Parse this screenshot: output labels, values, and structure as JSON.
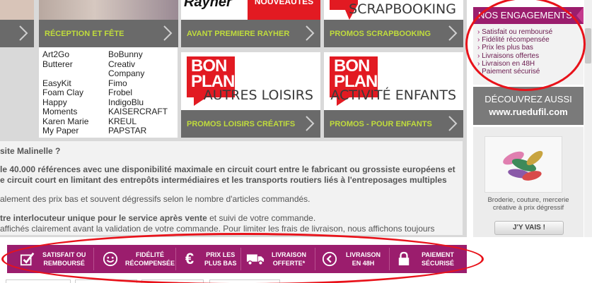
{
  "tiles": {
    "reception": {
      "label": "RÉCEPTION ET FÊTE"
    },
    "rayher": {
      "label": "AVANT PREMIERE RAYHER",
      "brand": "Rayher",
      "badge": "NOUVEAUTÉS"
    },
    "scrap": {
      "label": "PROMOS SCRAPBOOKING",
      "caption": "SCRAPBOOKING"
    },
    "autres": {
      "label": "PROMOS LOISIRS CRÉATIFS",
      "caption": "AUTRES LOISIRS",
      "badge_line1": "BON",
      "badge_line2": "PLAN"
    },
    "enfants": {
      "label": "PROMOS - POUR ENFANTS",
      "caption": "ACTIVITÉ ENFANTS",
      "badge_line1": "BON",
      "badge_line2": "PLAN"
    }
  },
  "brands": {
    "col1": [
      "Art2Go",
      "Butterer",
      "",
      "EasyKit",
      "Foam Clay",
      "Happy",
      "Moments",
      "Karen Marie",
      "My Paper"
    ],
    "col2": [
      "BoBunny",
      "Creativ",
      "Company",
      "Fimo",
      "Frobel",
      "IndigoBlu",
      "KAISERCRAFT",
      "KREUL",
      "PAPSTAR"
    ]
  },
  "text_block": {
    "heading": "site Malinelle ?",
    "line1": "le 40.000 références avec une disponibilité maximale en circuit court entre le fabricant ou grossiste européens et",
    "line2": "e circuit court en limitant des entrepôts intermédiaires et les transports routiers liés à l'entreposages multiples",
    "line3": "alement des prix bas et souvent dégressifs selon le nombre d'articles commandés.",
    "line4_bold": "tre interlocuteur unique pour le service après vente",
    "line4_rest": " et suivi de votre commande.",
    "line5": "affichés clairement avant la validation de votre commande. Pour limiter les frais de livraison, nous affichons toujours"
  },
  "sidebar": {
    "engagements_title": "NOS ENGAGEMENTS",
    "engagements": [
      "Satisfait ou remboursé",
      "Fidélité récompensée",
      "Prix les plus bas",
      "Livraisons offertes",
      "Livraison en 48H",
      "Paiement sécurisé"
    ],
    "decouvrez_line1": "DÉCOUVREZ AUSSI",
    "decouvrez_line2": "www.ruedufil.com",
    "rdf_text_line1": "Broderie, couture, mercerie",
    "rdf_text_line2": "créative à prix dégressif",
    "rdf_button": "J'Y VAIS !"
  },
  "guarantees": [
    {
      "icon": "check-box-icon",
      "line1": "SATISFAIT OU",
      "line2": "REMBOURSÉ"
    },
    {
      "icon": "smiley-icon",
      "line1": "FIDÉLITÉ",
      "line2": "RÉCOMPENSÉE"
    },
    {
      "icon": "euro-icon",
      "line1": "PRIX LES",
      "line2": "PLUS BAS"
    },
    {
      "icon": "truck-icon",
      "line1": "LIVRAISON",
      "line2": "OFFERTE*"
    },
    {
      "icon": "clock-arrow-icon",
      "line1": "LIVRAISON",
      "line2": "EN 48H"
    },
    {
      "icon": "padlock-icon",
      "line1": "PAIEMENT",
      "line2": "SÉCURISÉ"
    }
  ],
  "colors": {
    "brand_purple": "#9b1d6d",
    "tile_bar_grey": "#6a6a6a",
    "tile_label_green": "#c0dc3c",
    "bon_plan_red": "#e21a22",
    "annotation_red": "#e8121a"
  }
}
